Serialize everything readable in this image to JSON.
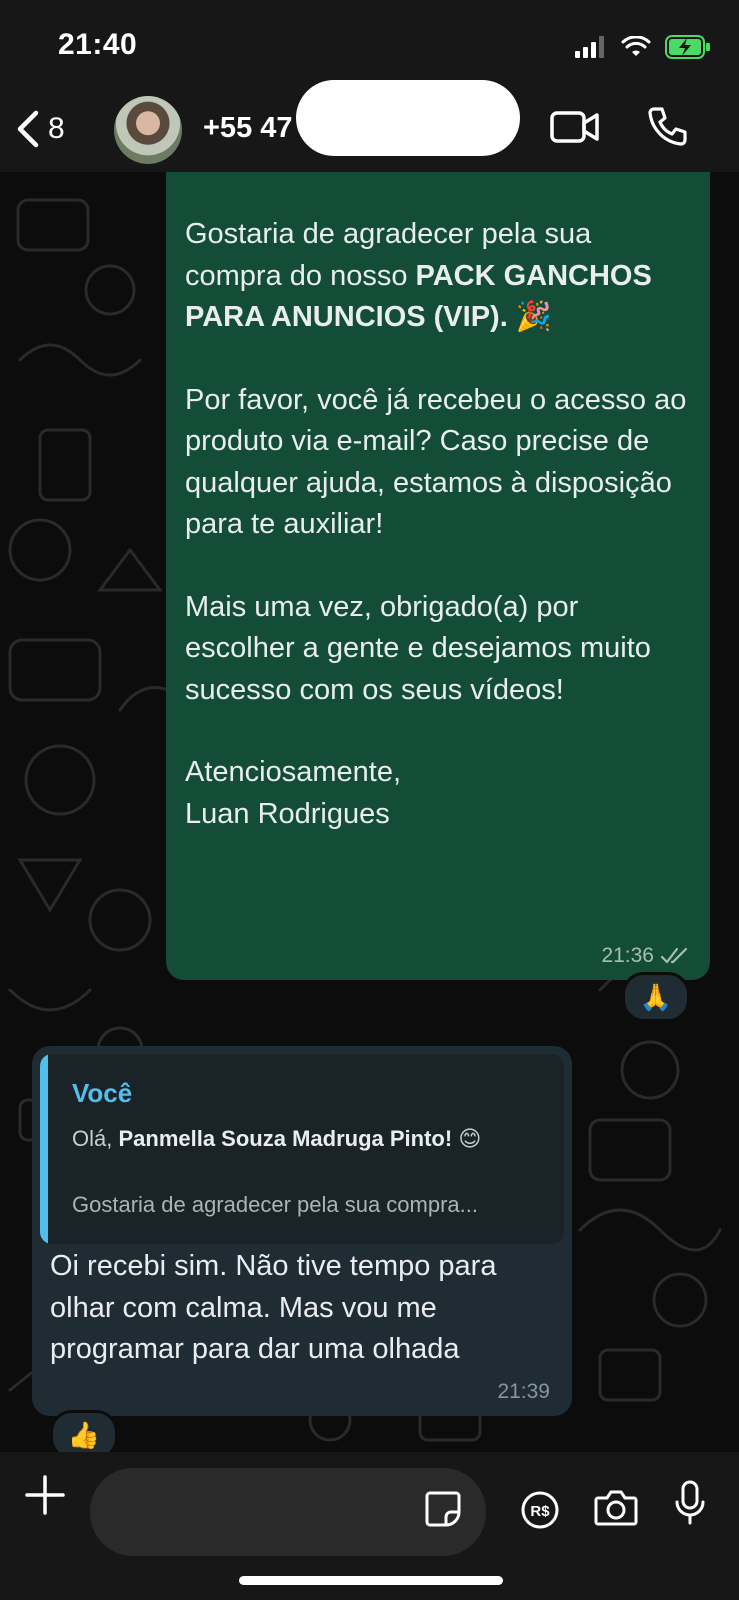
{
  "status_bar": {
    "time": "21:40"
  },
  "header": {
    "back_count": "8",
    "contact_name": "+55 47"
  },
  "messages": {
    "outgoing": {
      "line1": "Gostaria de agradecer pela sua compra do nosso ",
      "bold1": "PACK GANCHOS PARA ANUNCIOS (VIP).",
      "emoji1": "🎉",
      "para2": "Por favor, você já recebeu o acesso ao produto via e-mail? Caso precise de qualquer ajuda, estamos à disposição para te auxiliar!",
      "para3": "Mais uma vez, obrigado(a) por escolher a gente e desejamos muito sucesso com os seus vídeos!",
      "closing": "Atenciosamente,",
      "signature": "Luan Rodrigues",
      "time": "21:36",
      "reaction": "🙏"
    },
    "incoming": {
      "quote_author": "Você",
      "quote_prefix": "Olá, ",
      "quote_bold": "Panmella Souza Madruga Pinto!",
      "quote_emoji": "😊",
      "quote_line2": "Gostaria de agradecer pela sua compra...",
      "text": "Oi recebi sim. Não tive tempo para olhar com calma. Mas vou me programar para dar uma olhada",
      "time": "21:39",
      "reaction": "👍"
    }
  },
  "composer": {
    "placeholder": "",
    "pix_label": "R$"
  },
  "colors": {
    "outgoing_bubble": "#134d37",
    "incoming_bubble": "#202c33",
    "quote_accent": "#53bdeb"
  }
}
